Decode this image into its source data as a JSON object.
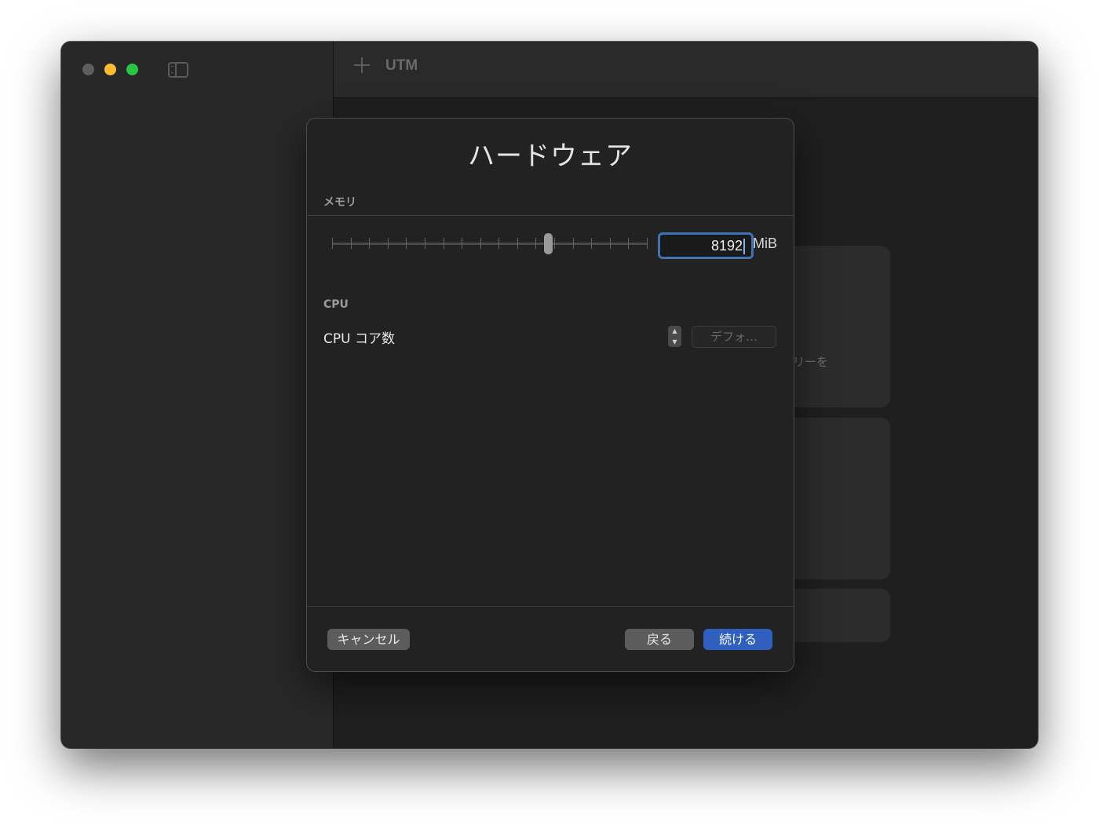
{
  "app": {
    "title": "UTM"
  },
  "background_cards": {
    "card1_text": "リーを",
    "card2_text": ""
  },
  "dialog": {
    "title": "ハードウェア",
    "memory": {
      "section_label": "メモリ",
      "value": "8192",
      "unit": "MiB",
      "slider_fraction": 0.69
    },
    "cpu": {
      "section_label": "CPU",
      "cores_label": "CPU コア数",
      "cores_placeholder": "デフォ…"
    },
    "buttons": {
      "cancel": "キャンセル",
      "back": "戻る",
      "continue": "続ける"
    }
  }
}
